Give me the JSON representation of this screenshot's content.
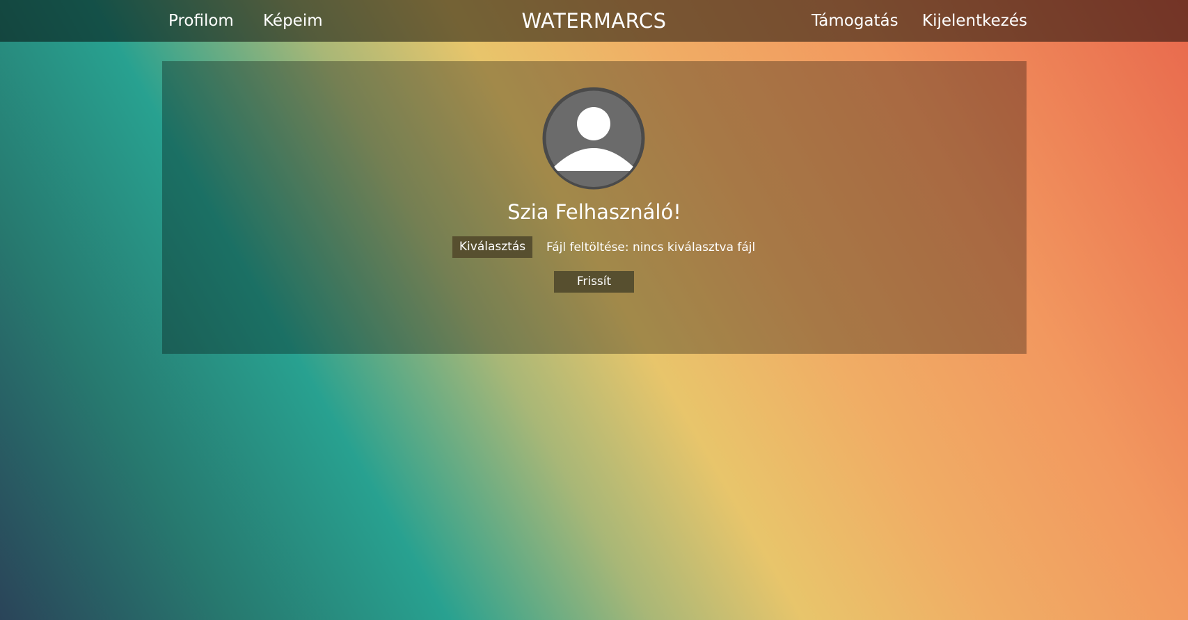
{
  "nav": {
    "links_left": [
      "Profilom",
      "Képeim"
    ],
    "brand": "WATERMARCS",
    "links_right": [
      "Támogatás",
      "Kijelentkezés"
    ]
  },
  "profile": {
    "avatar_icon": "user-icon",
    "greeting": "Szia Felhasználó!",
    "choose_label": "Kiválasztás",
    "file_status": "Fájl feltöltése: nincs kiválasztva fájl",
    "refresh_label": "Frissít"
  },
  "colors": {
    "nav_bg": "#00000080",
    "button_bg": "#574f2f",
    "avatar_fill": "#6b6b6b",
    "avatar_ring": "#4a4a4a"
  }
}
